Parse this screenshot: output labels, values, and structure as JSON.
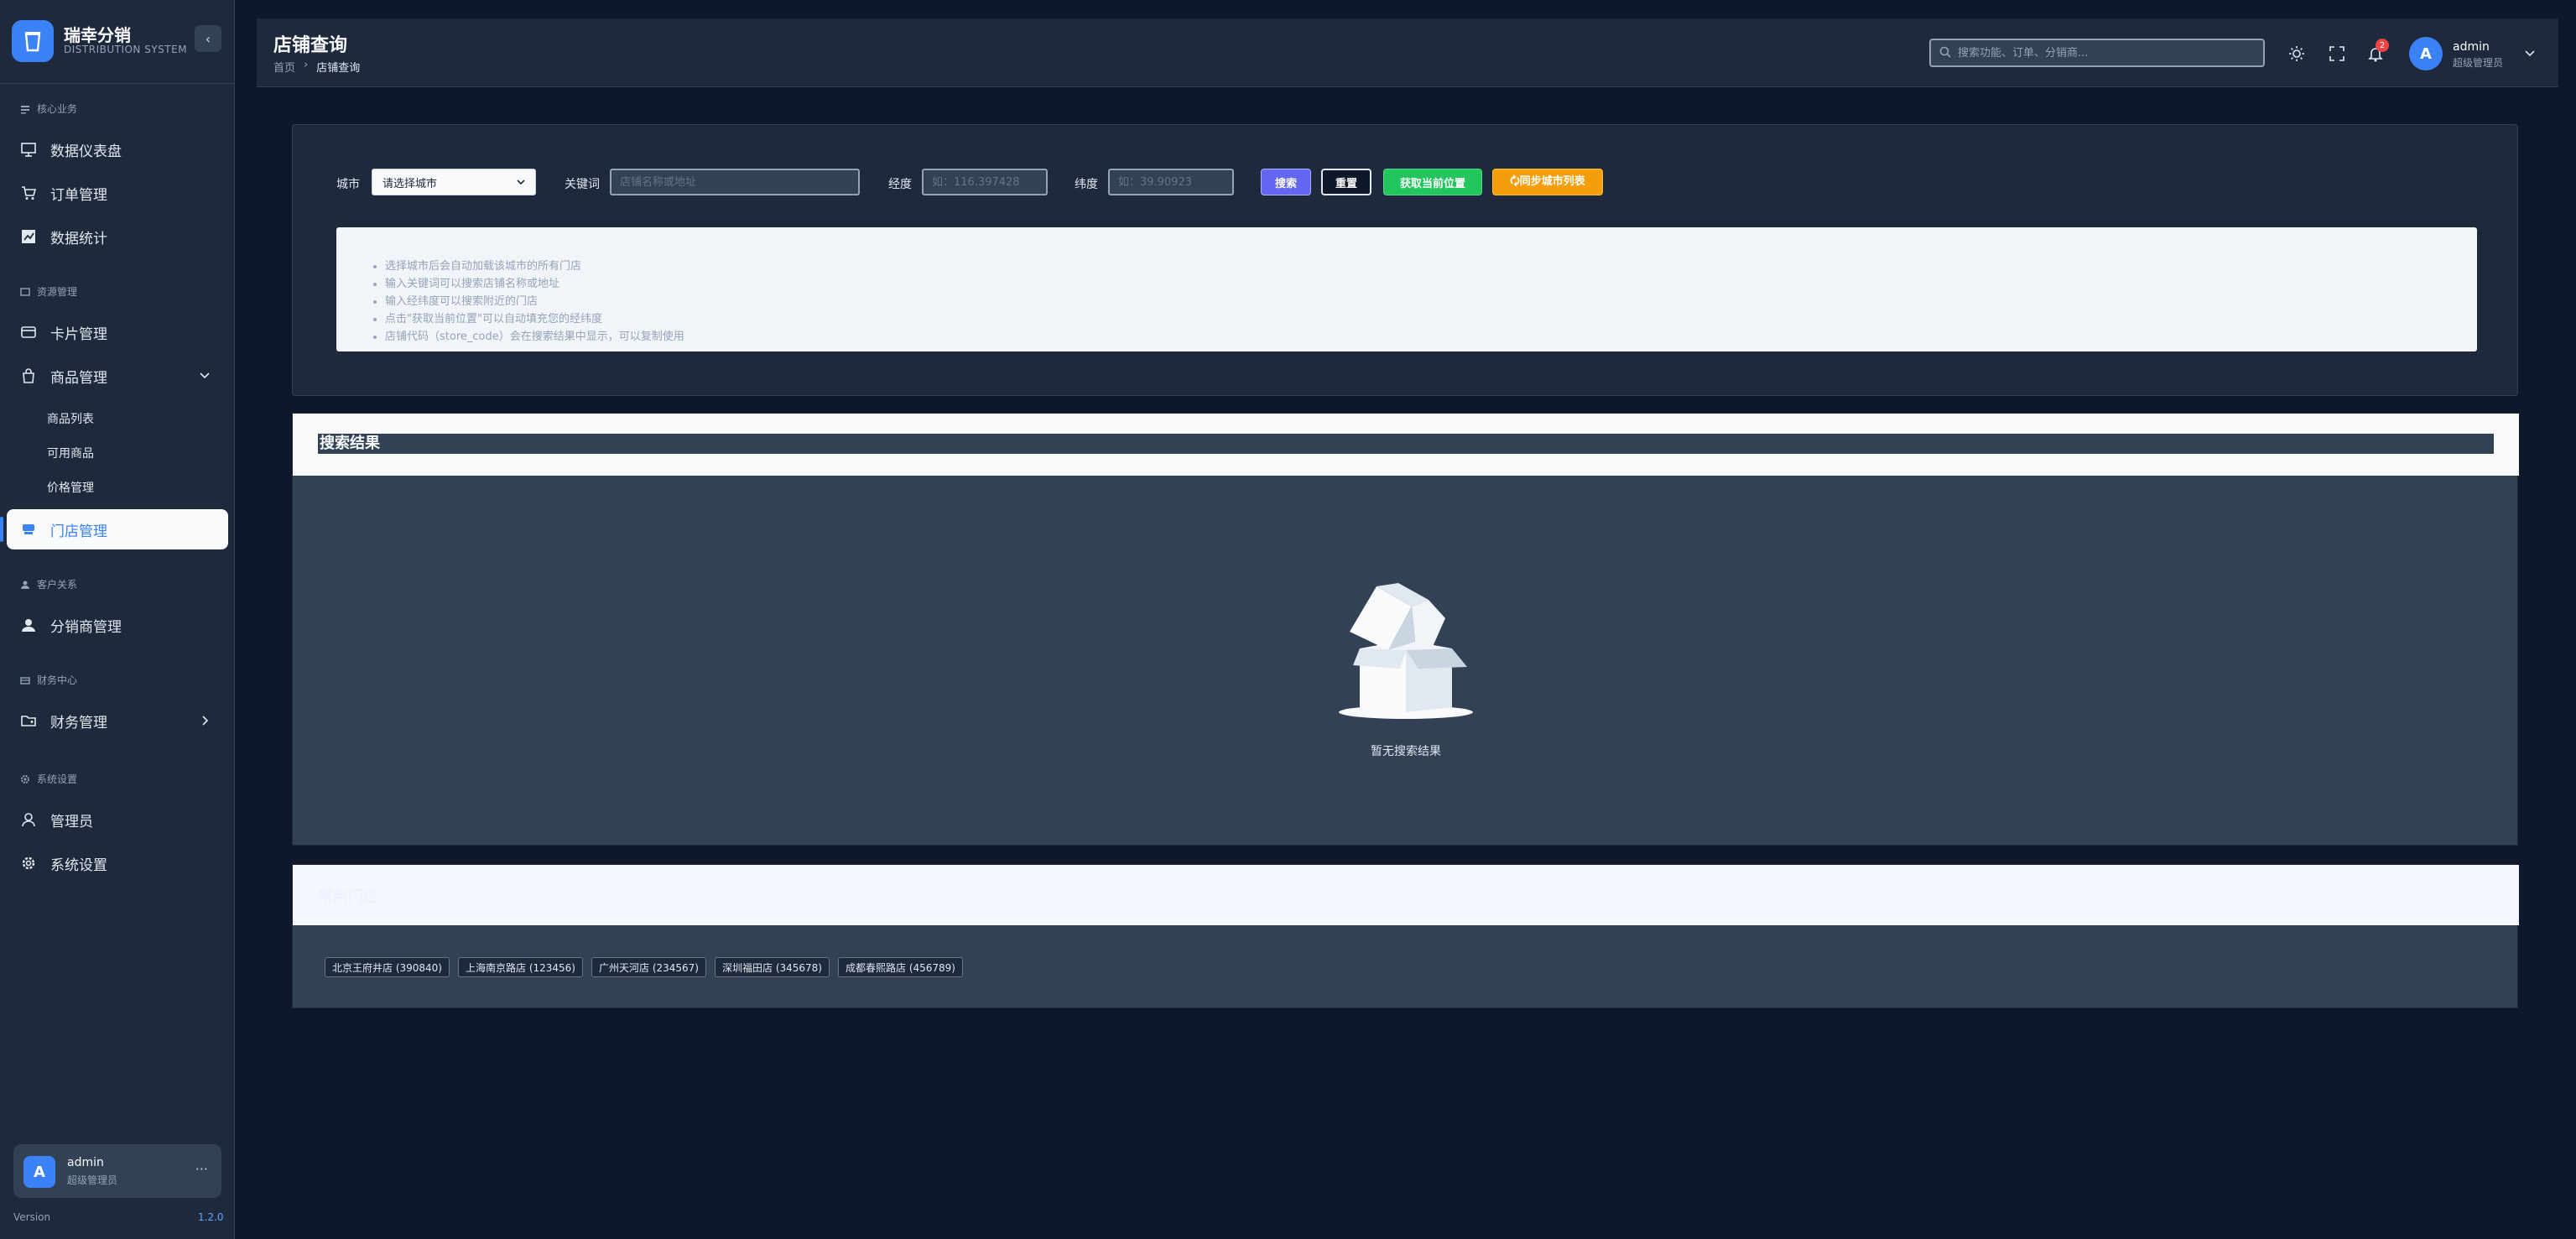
{
  "brand": {
    "title": "瑞幸分销",
    "subtitle": "DISTRIBUTION SYSTEM",
    "collapse_glyph": "‹"
  },
  "sidebar": {
    "sections": [
      {
        "label": "核心业务"
      },
      {
        "label": "资源管理"
      },
      {
        "label": "客户关系"
      },
      {
        "label": "财务中心"
      },
      {
        "label": "系统设置"
      }
    ],
    "items": [
      {
        "label": "数据仪表盘",
        "icon": "monitor-icon"
      },
      {
        "label": "订单管理",
        "icon": "cart-icon"
      },
      {
        "label": "数据统计",
        "icon": "chart-icon"
      },
      {
        "label": "卡片管理",
        "icon": "card-icon"
      },
      {
        "label": "商品管理",
        "icon": "bag-icon"
      },
      {
        "label": "门店管理",
        "icon": "store-icon",
        "active": true
      },
      {
        "label": "分销商管理",
        "icon": "user-icon"
      },
      {
        "label": "财务管理",
        "icon": "folder-icon"
      },
      {
        "label": "管理员",
        "icon": "admin-icon"
      },
      {
        "label": "系统设置",
        "icon": "gear-icon"
      }
    ],
    "subitems": [
      {
        "label": "商品列表"
      },
      {
        "label": "可用商品"
      },
      {
        "label": "价格管理"
      }
    ],
    "user": {
      "avatar": "A",
      "name": "admin",
      "role": "超级管理员",
      "more": "···"
    },
    "version_label": "Version",
    "version_value": "1.2.0"
  },
  "header": {
    "title": "店铺查询",
    "breadcrumb": [
      "首页",
      "›",
      "店铺查询"
    ],
    "search_placeholder": "搜索功能、订单、分销商...",
    "notification_count": "2",
    "user": {
      "avatar": "A",
      "name": "admin",
      "role": "超级管理员"
    }
  },
  "filters": {
    "city_label": "城市",
    "city_value": "请选择城市",
    "keyword_label": "关键词",
    "keyword_placeholder": "店铺名称或地址",
    "lng_label": "经度",
    "lng_placeholder": "如：116.397428",
    "lat_label": "纬度",
    "lat_placeholder": "如：39.90923",
    "search_btn": "搜索",
    "reset_btn": "重置",
    "locate_btn": "获取当前位置",
    "sync_btn": "🗘同步城市列表"
  },
  "tips": [
    "选择城市后会自动加载该城市的所有门店",
    "输入关键词可以搜索店铺名称或地址",
    "输入经纬度可以搜索附近的门店",
    "点击\"获取当前位置\"可以自动填充您的经纬度",
    "店铺代码（store_code）会在搜索结果中显示，可以复制使用"
  ],
  "results": {
    "title": "搜索结果",
    "empty_text": "暂无搜索结果",
    "empty_icon": "empty-box-icon"
  },
  "shortcuts": {
    "title": "常用门店",
    "chips": [
      "北京王府井店 (390840)",
      "上海南京路店 (123456)",
      "广州天河店 (234567)",
      "深圳福田店 (345678)",
      "成都春熙路店 (456789)"
    ]
  },
  "colors": {
    "accent": "#3b82f6",
    "sidebar_bg": "#1e293b",
    "page_bg": "#0f172a",
    "search_btn": "#6366f1",
    "locate_btn": "#22c55e",
    "sync_btn": "#f59e0b"
  }
}
